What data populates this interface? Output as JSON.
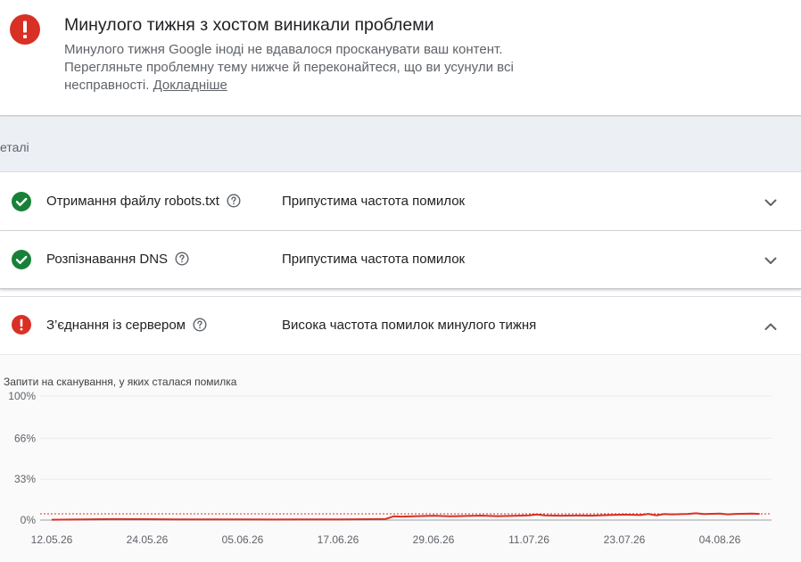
{
  "banner": {
    "title": "Минулого тижня з хостом виникали проблеми",
    "description": "Минулого тижня Google іноді не вдавалося просканувати ваш контент. Перегляньте проблемну тему нижче й переконайтеся, що ви усунули всі несправності.",
    "link_label": "Докладніше",
    "icon": "error-icon",
    "icon_color": "#d93025"
  },
  "details": {
    "label": "еталі"
  },
  "rows": [
    {
      "name": "Отримання файлу robots.txt",
      "status": "Припустима частота помилок",
      "icon": "check-circle-icon",
      "icon_color": "#188038",
      "expanded": false
    },
    {
      "name": "Розпізнавання DNS",
      "status": "Припустима частота помилок",
      "icon": "check-circle-icon",
      "icon_color": "#188038",
      "expanded": false
    },
    {
      "name": "З’єднання із сервером",
      "status": "Висока частота помилок минулого тижня",
      "icon": "error-icon",
      "icon_color": "#d93025",
      "expanded": true
    }
  ],
  "chart_data": {
    "type": "line",
    "title": "Запити на сканування, у яких сталася помилка",
    "xlabel": "",
    "ylabel": "",
    "y_ticks": [
      "100%",
      "66%",
      "33%",
      "0%"
    ],
    "y_tick_values": [
      100,
      66,
      33,
      0
    ],
    "ylim": [
      0,
      100
    ],
    "x_ticks": [
      "12.05.26",
      "24.05.26",
      "05.06.26",
      "17.06.26",
      "29.06.26",
      "11.07.26",
      "23.07.26",
      "04.08.26"
    ],
    "x_tick_days": [
      0,
      12,
      24,
      36,
      48,
      60,
      72,
      84
    ],
    "threshold": 5,
    "threshold_color": "#d93025",
    "series": [
      {
        "color": "#d93025",
        "x": [
          0,
          4,
          8,
          12,
          16,
          20,
          24,
          28,
          32,
          36,
          40,
          42,
          43,
          44,
          46,
          48,
          50,
          52,
          54,
          56,
          58,
          60,
          61,
          62,
          64,
          66,
          68,
          70,
          72,
          74,
          75,
          76,
          77,
          78,
          80,
          81,
          82,
          84,
          85,
          86,
          88,
          89
        ],
        "values": [
          0.3,
          0.6,
          0.8,
          0.7,
          0.5,
          0.6,
          0.5,
          0.4,
          0.6,
          0.5,
          0.7,
          0.9,
          3.0,
          2.8,
          3.2,
          3.5,
          3.0,
          3.3,
          3.6,
          3.2,
          3.4,
          3.8,
          4.5,
          3.8,
          3.5,
          3.7,
          3.6,
          4.0,
          4.4,
          4.0,
          5.0,
          3.8,
          4.8,
          4.6,
          5.0,
          5.5,
          4.8,
          5.2,
          4.6,
          5.0,
          5.2,
          5.0
        ]
      }
    ],
    "grid": true
  }
}
